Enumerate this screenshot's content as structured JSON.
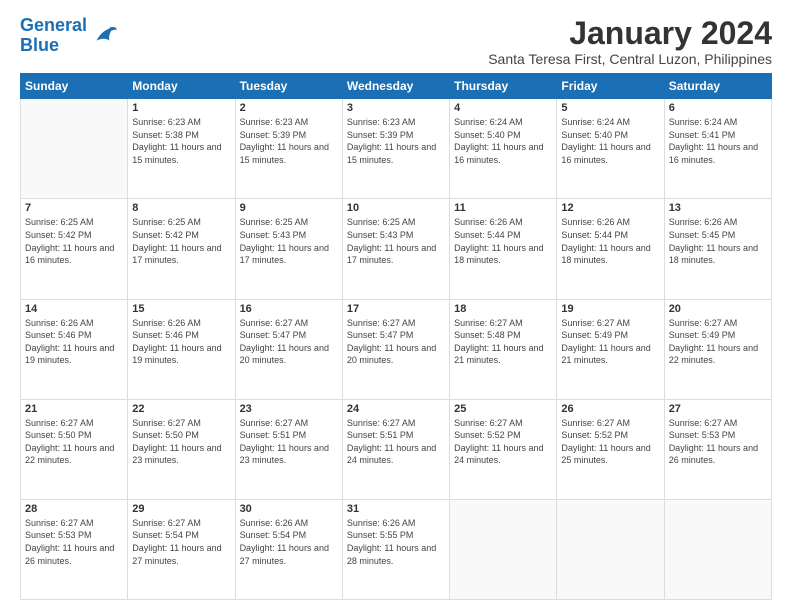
{
  "logo": {
    "line1": "General",
    "line2": "Blue"
  },
  "title": "January 2024",
  "subtitle": "Santa Teresa First, Central Luzon, Philippines",
  "days_header": [
    "Sunday",
    "Monday",
    "Tuesday",
    "Wednesday",
    "Thursday",
    "Friday",
    "Saturday"
  ],
  "weeks": [
    [
      {
        "num": "",
        "sunrise": "",
        "sunset": "",
        "daylight": ""
      },
      {
        "num": "1",
        "sunrise": "Sunrise: 6:23 AM",
        "sunset": "Sunset: 5:38 PM",
        "daylight": "Daylight: 11 hours and 15 minutes."
      },
      {
        "num": "2",
        "sunrise": "Sunrise: 6:23 AM",
        "sunset": "Sunset: 5:39 PM",
        "daylight": "Daylight: 11 hours and 15 minutes."
      },
      {
        "num": "3",
        "sunrise": "Sunrise: 6:23 AM",
        "sunset": "Sunset: 5:39 PM",
        "daylight": "Daylight: 11 hours and 15 minutes."
      },
      {
        "num": "4",
        "sunrise": "Sunrise: 6:24 AM",
        "sunset": "Sunset: 5:40 PM",
        "daylight": "Daylight: 11 hours and 16 minutes."
      },
      {
        "num": "5",
        "sunrise": "Sunrise: 6:24 AM",
        "sunset": "Sunset: 5:40 PM",
        "daylight": "Daylight: 11 hours and 16 minutes."
      },
      {
        "num": "6",
        "sunrise": "Sunrise: 6:24 AM",
        "sunset": "Sunset: 5:41 PM",
        "daylight": "Daylight: 11 hours and 16 minutes."
      }
    ],
    [
      {
        "num": "7",
        "sunrise": "Sunrise: 6:25 AM",
        "sunset": "Sunset: 5:42 PM",
        "daylight": "Daylight: 11 hours and 16 minutes."
      },
      {
        "num": "8",
        "sunrise": "Sunrise: 6:25 AM",
        "sunset": "Sunset: 5:42 PM",
        "daylight": "Daylight: 11 hours and 17 minutes."
      },
      {
        "num": "9",
        "sunrise": "Sunrise: 6:25 AM",
        "sunset": "Sunset: 5:43 PM",
        "daylight": "Daylight: 11 hours and 17 minutes."
      },
      {
        "num": "10",
        "sunrise": "Sunrise: 6:25 AM",
        "sunset": "Sunset: 5:43 PM",
        "daylight": "Daylight: 11 hours and 17 minutes."
      },
      {
        "num": "11",
        "sunrise": "Sunrise: 6:26 AM",
        "sunset": "Sunset: 5:44 PM",
        "daylight": "Daylight: 11 hours and 18 minutes."
      },
      {
        "num": "12",
        "sunrise": "Sunrise: 6:26 AM",
        "sunset": "Sunset: 5:44 PM",
        "daylight": "Daylight: 11 hours and 18 minutes."
      },
      {
        "num": "13",
        "sunrise": "Sunrise: 6:26 AM",
        "sunset": "Sunset: 5:45 PM",
        "daylight": "Daylight: 11 hours and 18 minutes."
      }
    ],
    [
      {
        "num": "14",
        "sunrise": "Sunrise: 6:26 AM",
        "sunset": "Sunset: 5:46 PM",
        "daylight": "Daylight: 11 hours and 19 minutes."
      },
      {
        "num": "15",
        "sunrise": "Sunrise: 6:26 AM",
        "sunset": "Sunset: 5:46 PM",
        "daylight": "Daylight: 11 hours and 19 minutes."
      },
      {
        "num": "16",
        "sunrise": "Sunrise: 6:27 AM",
        "sunset": "Sunset: 5:47 PM",
        "daylight": "Daylight: 11 hours and 20 minutes."
      },
      {
        "num": "17",
        "sunrise": "Sunrise: 6:27 AM",
        "sunset": "Sunset: 5:47 PM",
        "daylight": "Daylight: 11 hours and 20 minutes."
      },
      {
        "num": "18",
        "sunrise": "Sunrise: 6:27 AM",
        "sunset": "Sunset: 5:48 PM",
        "daylight": "Daylight: 11 hours and 21 minutes."
      },
      {
        "num": "19",
        "sunrise": "Sunrise: 6:27 AM",
        "sunset": "Sunset: 5:49 PM",
        "daylight": "Daylight: 11 hours and 21 minutes."
      },
      {
        "num": "20",
        "sunrise": "Sunrise: 6:27 AM",
        "sunset": "Sunset: 5:49 PM",
        "daylight": "Daylight: 11 hours and 22 minutes."
      }
    ],
    [
      {
        "num": "21",
        "sunrise": "Sunrise: 6:27 AM",
        "sunset": "Sunset: 5:50 PM",
        "daylight": "Daylight: 11 hours and 22 minutes."
      },
      {
        "num": "22",
        "sunrise": "Sunrise: 6:27 AM",
        "sunset": "Sunset: 5:50 PM",
        "daylight": "Daylight: 11 hours and 23 minutes."
      },
      {
        "num": "23",
        "sunrise": "Sunrise: 6:27 AM",
        "sunset": "Sunset: 5:51 PM",
        "daylight": "Daylight: 11 hours and 23 minutes."
      },
      {
        "num": "24",
        "sunrise": "Sunrise: 6:27 AM",
        "sunset": "Sunset: 5:51 PM",
        "daylight": "Daylight: 11 hours and 24 minutes."
      },
      {
        "num": "25",
        "sunrise": "Sunrise: 6:27 AM",
        "sunset": "Sunset: 5:52 PM",
        "daylight": "Daylight: 11 hours and 24 minutes."
      },
      {
        "num": "26",
        "sunrise": "Sunrise: 6:27 AM",
        "sunset": "Sunset: 5:52 PM",
        "daylight": "Daylight: 11 hours and 25 minutes."
      },
      {
        "num": "27",
        "sunrise": "Sunrise: 6:27 AM",
        "sunset": "Sunset: 5:53 PM",
        "daylight": "Daylight: 11 hours and 26 minutes."
      }
    ],
    [
      {
        "num": "28",
        "sunrise": "Sunrise: 6:27 AM",
        "sunset": "Sunset: 5:53 PM",
        "daylight": "Daylight: 11 hours and 26 minutes."
      },
      {
        "num": "29",
        "sunrise": "Sunrise: 6:27 AM",
        "sunset": "Sunset: 5:54 PM",
        "daylight": "Daylight: 11 hours and 27 minutes."
      },
      {
        "num": "30",
        "sunrise": "Sunrise: 6:26 AM",
        "sunset": "Sunset: 5:54 PM",
        "daylight": "Daylight: 11 hours and 27 minutes."
      },
      {
        "num": "31",
        "sunrise": "Sunrise: 6:26 AM",
        "sunset": "Sunset: 5:55 PM",
        "daylight": "Daylight: 11 hours and 28 minutes."
      },
      {
        "num": "",
        "sunrise": "",
        "sunset": "",
        "daylight": ""
      },
      {
        "num": "",
        "sunrise": "",
        "sunset": "",
        "daylight": ""
      },
      {
        "num": "",
        "sunrise": "",
        "sunset": "",
        "daylight": ""
      }
    ]
  ]
}
